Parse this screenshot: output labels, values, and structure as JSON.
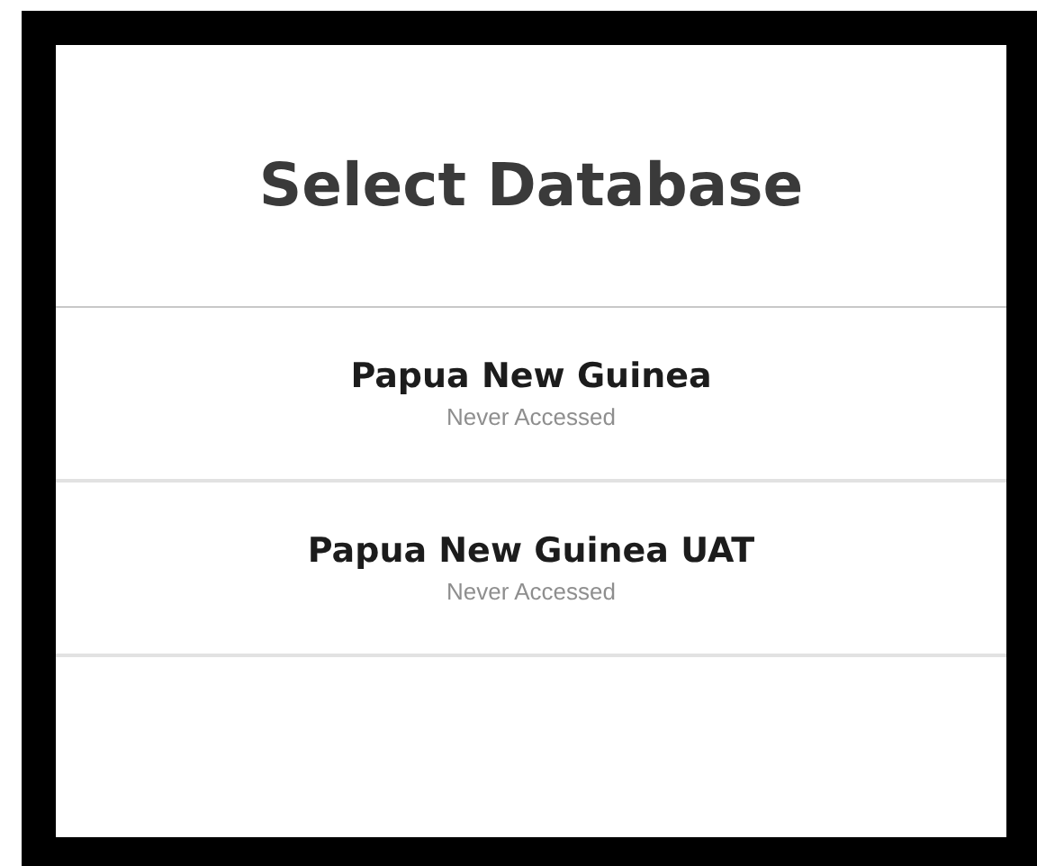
{
  "title": "Select Database",
  "databases": [
    {
      "name": "Papua New Guinea",
      "status": "Never Accessed"
    },
    {
      "name": "Papua New Guinea UAT",
      "status": "Never Accessed"
    }
  ]
}
